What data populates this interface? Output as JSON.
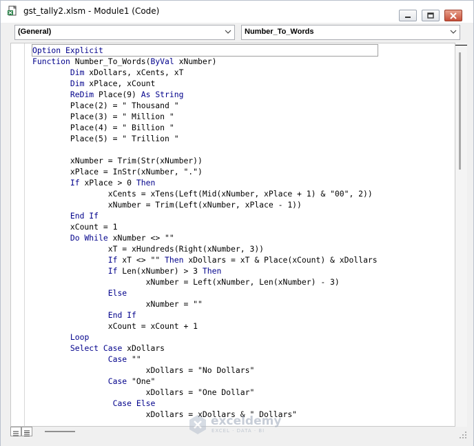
{
  "window": {
    "title": "gst_tally2.xlsm - Module1 (Code)"
  },
  "toolbar": {
    "object_combo": "(General)",
    "procedure_combo": "Number_To_Words"
  },
  "code_lines": [
    [
      {
        "t": "Option Explicit",
        "k": 1
      }
    ],
    [
      {
        "t": "Function",
        "k": 1
      },
      {
        "t": " Number_To_Words(",
        "k": 0
      },
      {
        "t": "ByVal",
        "k": 1
      },
      {
        "t": " xNumber)",
        "k": 0
      }
    ],
    [
      {
        "t": "        ",
        "k": 0
      },
      {
        "t": "Dim",
        "k": 1
      },
      {
        "t": " xDollars, xCents, xT",
        "k": 0
      }
    ],
    [
      {
        "t": "        ",
        "k": 0
      },
      {
        "t": "Dim",
        "k": 1
      },
      {
        "t": " xPlace, xCount",
        "k": 0
      }
    ],
    [
      {
        "t": "        ",
        "k": 0
      },
      {
        "t": "ReDim",
        "k": 1
      },
      {
        "t": " Place(9) ",
        "k": 0
      },
      {
        "t": "As String",
        "k": 1
      }
    ],
    [
      {
        "t": "        Place(2) = \" Thousand \"",
        "k": 0
      }
    ],
    [
      {
        "t": "        Place(3) = \" Million \"",
        "k": 0
      }
    ],
    [
      {
        "t": "        Place(4) = \" Billion \"",
        "k": 0
      }
    ],
    [
      {
        "t": "        Place(5) = \" Trillion \"",
        "k": 0
      }
    ],
    [
      {
        "t": "",
        "k": 0
      }
    ],
    [
      {
        "t": "        xNumber = Trim(Str(xNumber))",
        "k": 0
      }
    ],
    [
      {
        "t": "        xPlace = InStr(xNumber, \".\")",
        "k": 0
      }
    ],
    [
      {
        "t": "        ",
        "k": 0
      },
      {
        "t": "If",
        "k": 1
      },
      {
        "t": " xPlace > 0 ",
        "k": 0
      },
      {
        "t": "Then",
        "k": 1
      }
    ],
    [
      {
        "t": "                xCents = xTens(Left(Mid(xNumber, xPlace + 1) & \"00\", 2))",
        "k": 0
      }
    ],
    [
      {
        "t": "                xNumber = Trim(Left(xNumber, xPlace - 1))",
        "k": 0
      }
    ],
    [
      {
        "t": "        ",
        "k": 0
      },
      {
        "t": "End If",
        "k": 1
      }
    ],
    [
      {
        "t": "        xCount = 1",
        "k": 0
      }
    ],
    [
      {
        "t": "        ",
        "k": 0
      },
      {
        "t": "Do While",
        "k": 1
      },
      {
        "t": " xNumber <> \"\"",
        "k": 0
      }
    ],
    [
      {
        "t": "                xT = xHundreds(Right(xNumber, 3))",
        "k": 0
      }
    ],
    [
      {
        "t": "                ",
        "k": 0
      },
      {
        "t": "If",
        "k": 1
      },
      {
        "t": " xT <> \"\" ",
        "k": 0
      },
      {
        "t": "Then",
        "k": 1
      },
      {
        "t": " xDollars = xT & Place(xCount) & xDollars",
        "k": 0
      }
    ],
    [
      {
        "t": "                ",
        "k": 0
      },
      {
        "t": "If",
        "k": 1
      },
      {
        "t": " Len(xNumber) > 3 ",
        "k": 0
      },
      {
        "t": "Then",
        "k": 1
      }
    ],
    [
      {
        "t": "                        xNumber = Left(xNumber, Len(xNumber) - 3)",
        "k": 0
      }
    ],
    [
      {
        "t": "                ",
        "k": 0
      },
      {
        "t": "Else",
        "k": 1
      }
    ],
    [
      {
        "t": "                        xNumber = \"\"",
        "k": 0
      }
    ],
    [
      {
        "t": "                ",
        "k": 0
      },
      {
        "t": "End If",
        "k": 1
      }
    ],
    [
      {
        "t": "                xCount = xCount + 1",
        "k": 0
      }
    ],
    [
      {
        "t": "        ",
        "k": 0
      },
      {
        "t": "Loop",
        "k": 1
      }
    ],
    [
      {
        "t": "        ",
        "k": 0
      },
      {
        "t": "Select Case",
        "k": 1
      },
      {
        "t": " xDollars",
        "k": 0
      }
    ],
    [
      {
        "t": "                ",
        "k": 0
      },
      {
        "t": "Case",
        "k": 1
      },
      {
        "t": " \"\"",
        "k": 0
      }
    ],
    [
      {
        "t": "                        xDollars = \"No Dollars\"",
        "k": 0
      }
    ],
    [
      {
        "t": "                ",
        "k": 0
      },
      {
        "t": "Case",
        "k": 1
      },
      {
        "t": " \"One\"",
        "k": 0
      }
    ],
    [
      {
        "t": "                        xDollars = \"One Dollar\"",
        "k": 0
      }
    ],
    [
      {
        "t": "                 ",
        "k": 0
      },
      {
        "t": "Case Else",
        "k": 1
      }
    ],
    [
      {
        "t": "                        xDollars = xDollars & \" Dollars\"",
        "k": 0
      }
    ]
  ],
  "watermark": {
    "name": "exceldemy",
    "tagline": "EXCEL · DATA · BI"
  },
  "colors": {
    "keyword": "#00008b",
    "text": "#000000",
    "close_button": "#c7503a"
  },
  "icons": [
    "excel-doc-icon",
    "minimize-icon",
    "restore-icon",
    "close-icon",
    "chevron-down-icon",
    "procedure-view-icon",
    "full-module-view-icon",
    "resize-grip-icon"
  ]
}
